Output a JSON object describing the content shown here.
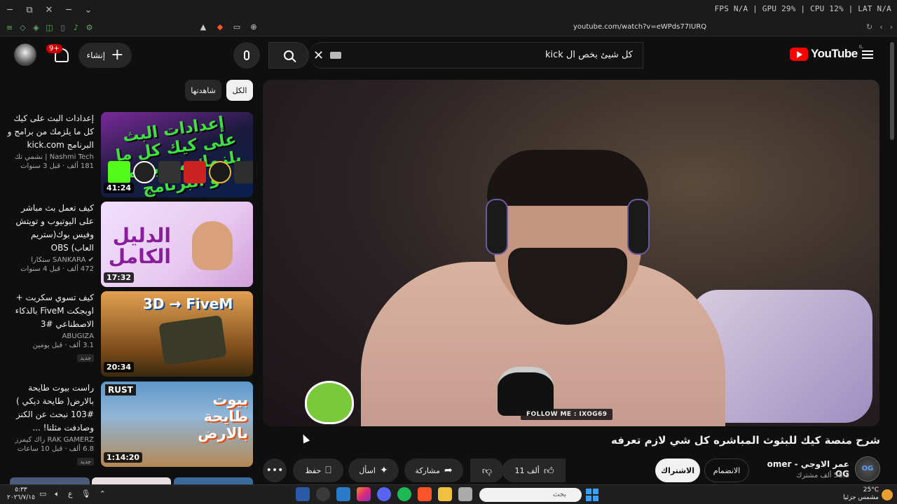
{
  "os": {
    "minimize": "─",
    "restore": "⧉",
    "close": "✕",
    "stats": "FPS N/A | GPU 29% | CPU 12% | LAT N/A"
  },
  "browser": {
    "url": "youtube.com/watch?v=eWPds77IURQ"
  },
  "header": {
    "create_label": "إنشاء",
    "notifications_badge": "9+",
    "search_value": "كل شيئ بخص ال kick",
    "logo_text": "YouTube",
    "logo_region": "IL"
  },
  "chips": {
    "all": "الكل",
    "watched": "شاهدتها"
  },
  "recommendations": [
    {
      "title": "إعدادات البث على كيك كل ما يلزمك من برامج و البرنامج kick.com",
      "channel": "Nashmi Tech | نشمي تك",
      "views": "181 ألف · قبل 3 سنوات",
      "duration": "41:24",
      "thumb_text": "إعدادات البث على كيك كل ما يلزمك من برامج و البرنامج"
    },
    {
      "title": "كيف تعمل بث مباشر على اليوتيوب و تويتش وفيس بوك(ستريم العاب) OBS",
      "channel": "SANKARA سنكارا",
      "views": "472 ألف · قبل 4 سنوات",
      "duration": "17:32",
      "thumb_text": "الدليل الكامل"
    },
    {
      "title": "كيف تسوي سكربت + اوبجكت FiveM بالذكاء الاصطناعي #3",
      "channel": "ABUGIZA",
      "views": "3.1 ألف · قبل يومين",
      "badge": "جديد",
      "duration": "20:34",
      "thumb_text": "3D → FiveM"
    },
    {
      "title": "راست بيوت طايحة بالارض( طايحة ديكي ) #103 نبحث عن الكنز وصادفت مثلنا! ...",
      "channel": "RAK GAMERZ راك كيمرز",
      "views": "6.8 ألف · قبل 10 ساعات",
      "badge": "جديد",
      "duration": "1:14:20",
      "thumb_text": "بيوت طايحة بالارض",
      "thumb_tag": "RUST"
    }
  ],
  "video": {
    "title": "شرح منصة كيك للبثوث المباشره كل شي لازم تعرفه",
    "overlay_text": "FOLLOW ME : IXOG69",
    "channel_name": "عمر الاوجي - omer OG",
    "channel_subs": "58.3 ألف مشترك",
    "channel_avatar_text": "OG",
    "subscribe_label": "الاشتراك",
    "join_label": "الانضمام",
    "like_count": "11 ألف",
    "share_label": "مشاركة",
    "ask_label": "اسأل",
    "save_label": "حفظ"
  },
  "taskbar": {
    "time": "٥:٣٣",
    "date": "٢٠٢٦/٧/١٥",
    "lang": "ع",
    "search_placeholder": "بحث",
    "temp": "25°C",
    "weather": "مشمس جزئيا"
  },
  "colors": {
    "brand_red": "#ff0000",
    "background": "#0f0f0f",
    "chip_active": "#f1f1f1",
    "surface": "#272727"
  }
}
